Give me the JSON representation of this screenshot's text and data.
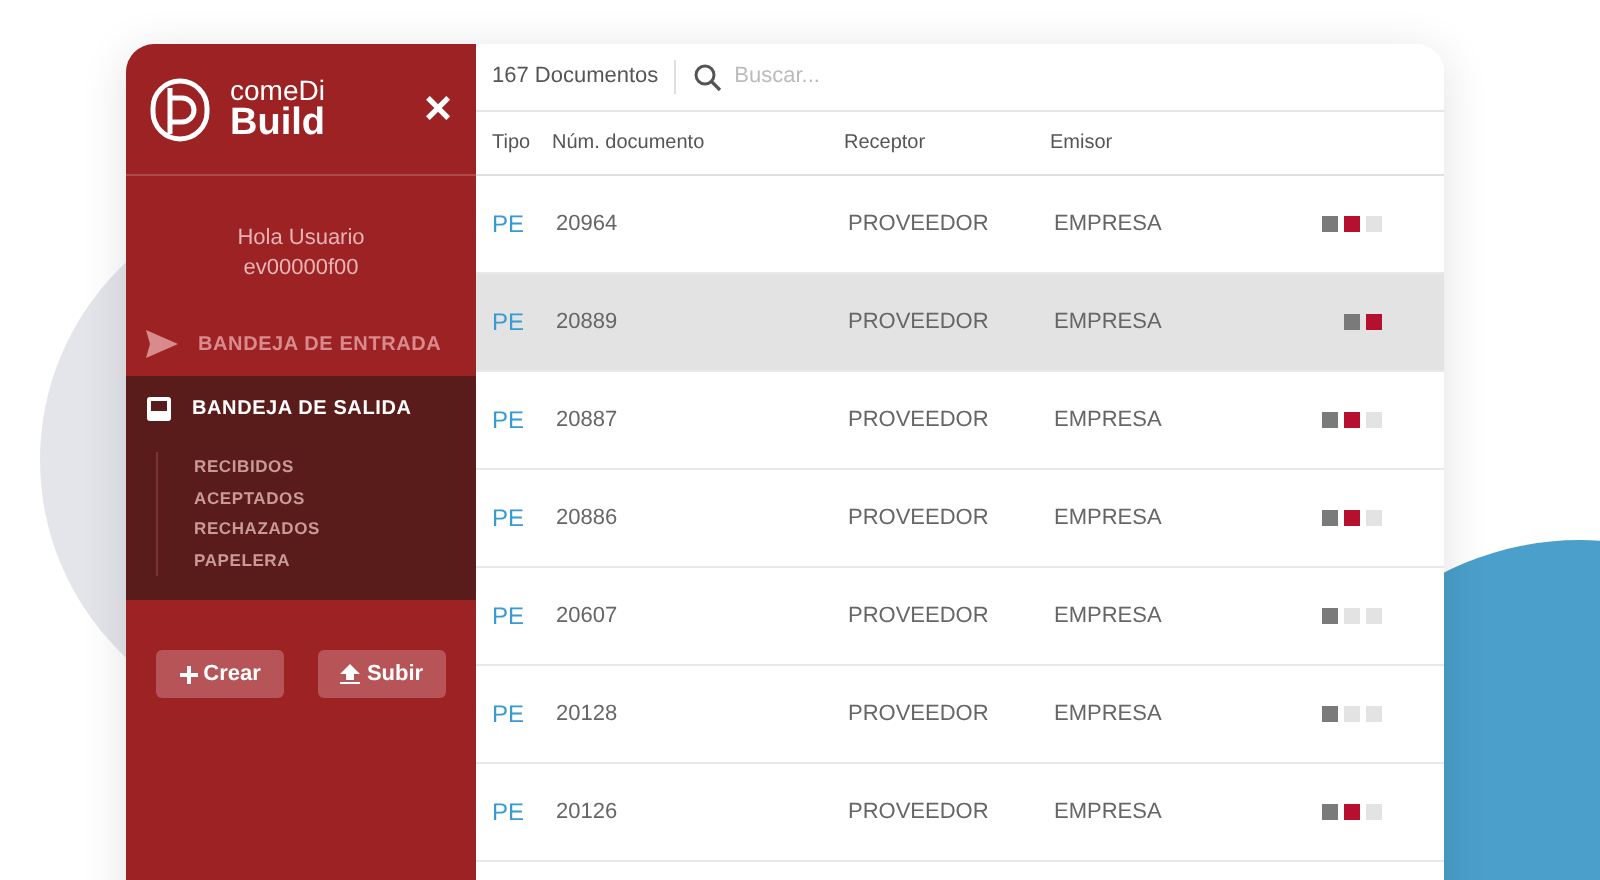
{
  "sidebar": {
    "logo": {
      "line1": "comeDi",
      "line2": "Build"
    },
    "close": "×",
    "greeting": "Hola Usuario",
    "user_id": "ev00000f00",
    "nav": [
      {
        "label": "BANDEJA DE ENTRADA",
        "selected": false
      },
      {
        "label": "BANDEJA DE SALIDA",
        "selected": true,
        "children": [
          {
            "label": "RECIBIDOS"
          },
          {
            "label": "ACEPTADOS"
          },
          {
            "label": "RECHAZADOS"
          },
          {
            "label": "PAPELERA"
          }
        ]
      }
    ],
    "buttons": [
      {
        "label": "Crear"
      },
      {
        "label": "Subir"
      }
    ]
  },
  "toolbar": {
    "count": "167 Documentos",
    "search": {
      "placeholder": "Buscar..."
    }
  },
  "table": {
    "columns": [
      "Tipo",
      "Núm. documento",
      "Receptor",
      "Emisor"
    ],
    "rows": [
      {
        "tipo": "PE",
        "numero": "20964",
        "receptor": "PROVEEDOR",
        "emisor": "EMPRESA",
        "selected": false,
        "status": [
          {
            "color": "#7a7a7a"
          },
          {
            "color": "#b5102e"
          },
          {
            "color": "#e3e3e3"
          }
        ]
      },
      {
        "tipo": "PE",
        "numero": "20889",
        "receptor": "PROVEEDOR",
        "emisor": "EMPRESA",
        "selected": true,
        "status": [
          {
            "color": "#7a7a7a"
          },
          {
            "color": "#b5102e"
          }
        ]
      },
      {
        "tipo": "PE",
        "numero": "20887",
        "receptor": "PROVEEDOR",
        "emisor": "EMPRESA",
        "selected": false,
        "status": [
          {
            "color": "#7a7a7a"
          },
          {
            "color": "#b5102e"
          },
          {
            "color": "#e3e3e3"
          }
        ]
      },
      {
        "tipo": "PE",
        "numero": "20886",
        "receptor": "PROVEEDOR",
        "emisor": "EMPRESA",
        "selected": false,
        "status": [
          {
            "color": "#7a7a7a"
          },
          {
            "color": "#b5102e"
          },
          {
            "color": "#e3e3e3"
          }
        ]
      },
      {
        "tipo": "PE",
        "numero": "20607",
        "receptor": "PROVEEDOR",
        "emisor": "EMPRESA",
        "selected": false,
        "status": [
          {
            "color": "#7a7a7a"
          },
          {
            "color": "#e3e3e3"
          },
          {
            "color": "#e3e3e3"
          }
        ]
      },
      {
        "tipo": "PE",
        "numero": "20128",
        "receptor": "PROVEEDOR",
        "emisor": "EMPRESA",
        "selected": false,
        "status": [
          {
            "color": "#7a7a7a"
          },
          {
            "color": "#e3e3e3"
          },
          {
            "color": "#e3e3e3"
          }
        ]
      },
      {
        "tipo": "PE",
        "numero": "20126",
        "receptor": "PROVEEDOR",
        "emisor": "EMPRESA",
        "selected": false,
        "status": [
          {
            "color": "#7a7a7a"
          },
          {
            "color": "#b5102e"
          },
          {
            "color": "#e3e3e3"
          }
        ]
      }
    ]
  }
}
